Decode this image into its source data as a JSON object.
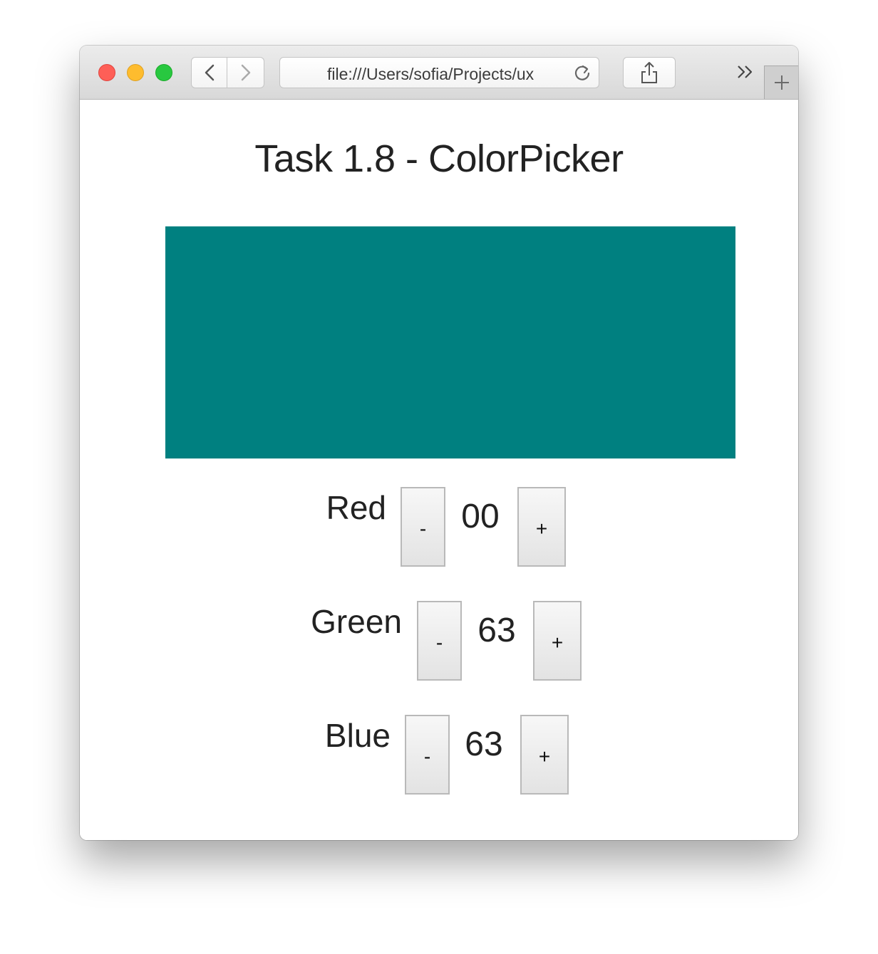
{
  "browser": {
    "address_text": "file:///Users/sofia/Projects/ux",
    "new_tab_label": "+",
    "overflow_label": "»"
  },
  "page": {
    "title": "Task 1.8 - ColorPicker"
  },
  "swatch": {
    "color": "#008080"
  },
  "channels": [
    {
      "label": "Red",
      "value": "00",
      "minus_label": "-",
      "plus_label": "+"
    },
    {
      "label": "Green",
      "value": "63",
      "minus_label": "-",
      "plus_label": "+"
    },
    {
      "label": "Blue",
      "value": "63",
      "minus_label": "-",
      "plus_label": "+"
    }
  ],
  "colors": {
    "swatch": "#008080",
    "text": "#222222"
  }
}
